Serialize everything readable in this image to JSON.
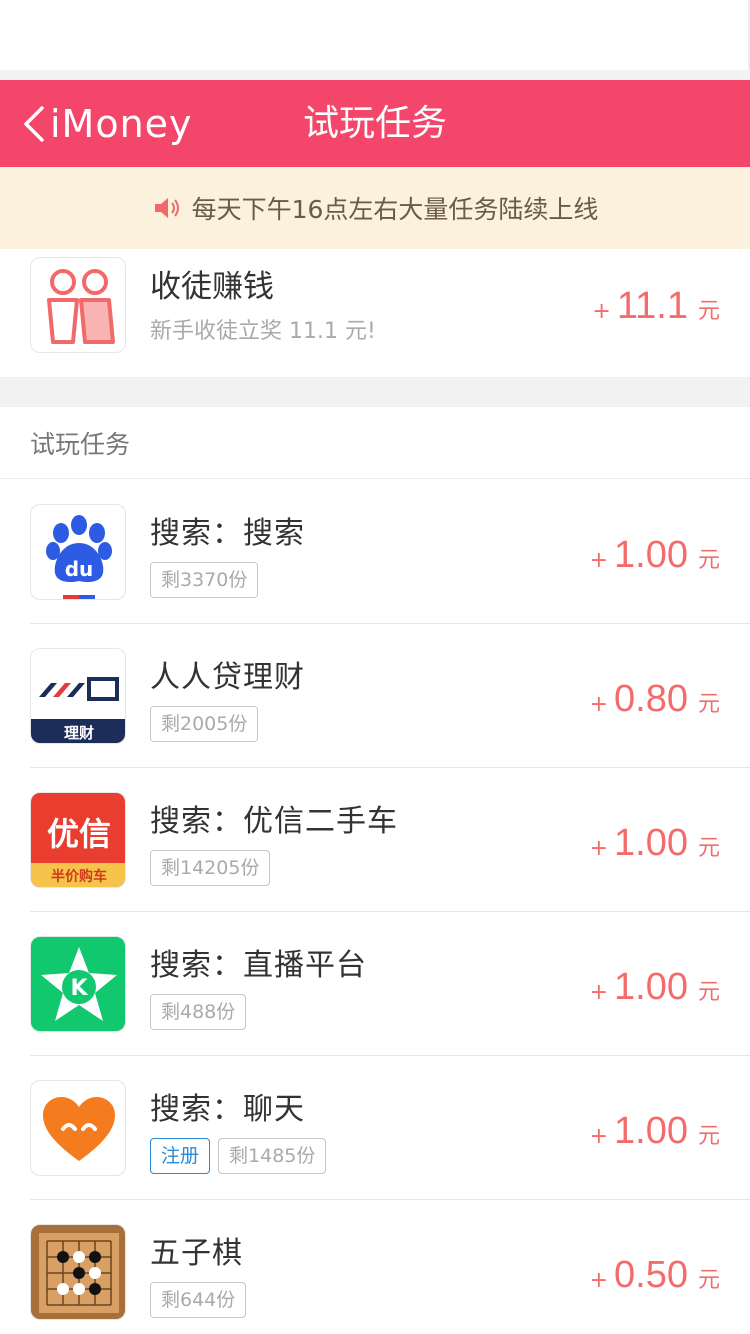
{
  "nav": {
    "back_label": "iMoney",
    "title": "试玩任务",
    "color": "#f4456a"
  },
  "notice": {
    "text": "每天下午16点左右大量任务陆续上线"
  },
  "invite": {
    "title": "收徒赚钱",
    "subtitle": "新手收徒立奖 11.1 元!",
    "plus": "+",
    "amount": "11.1",
    "unit": "元"
  },
  "section": {
    "label": "试玩任务"
  },
  "tasks": [
    {
      "title": "搜索：搜索",
      "tags": [
        "剩3370份"
      ],
      "plus": "+",
      "amount": "1.00",
      "unit": "元",
      "icon": "baidu-icon"
    },
    {
      "title": "人人贷理财",
      "tags": [
        "剩2005份"
      ],
      "plus": "+",
      "amount": "0.80",
      "unit": "元",
      "icon": "renrendai-icon",
      "icon_text": "理财"
    },
    {
      "title": "搜索：优信二手车",
      "tags": [
        "剩14205份"
      ],
      "plus": "+",
      "amount": "1.00",
      "unit": "元",
      "icon": "youxin-icon",
      "icon_text": "优信",
      "icon_sub": "半价购车"
    },
    {
      "title": "搜索：直播平台",
      "tags": [
        "剩488份"
      ],
      "plus": "+",
      "amount": "1.00",
      "unit": "元",
      "icon": "kuaishou-k-icon",
      "icon_text": "K"
    },
    {
      "title": "搜索：聊天",
      "tags": [
        "注册",
        "剩1485份"
      ],
      "plus": "+",
      "amount": "1.00",
      "unit": "元",
      "icon": "heart-chat-icon"
    },
    {
      "title": "五子棋",
      "tags": [
        "剩644份"
      ],
      "plus": "+",
      "amount": "0.50",
      "unit": "元",
      "icon": "gomoku-icon"
    }
  ]
}
